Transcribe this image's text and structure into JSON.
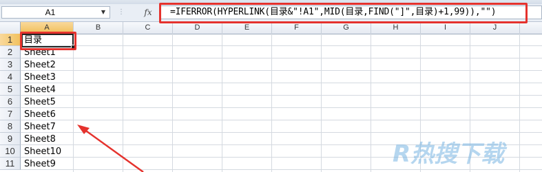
{
  "name_box": {
    "value": "A1"
  },
  "formula_bar": {
    "fx_label": "fx",
    "formula": "=IFERROR(HYPERLINK(目录&\"!A1\",MID(目录,FIND(\"]\",目录)+1,99)),\"\")"
  },
  "columns": [
    "A",
    "B",
    "C",
    "D",
    "E",
    "F",
    "G",
    "H",
    "I",
    "J"
  ],
  "rows": [
    "1",
    "2",
    "3",
    "4",
    "5",
    "6",
    "7",
    "8",
    "9",
    "10",
    "11"
  ],
  "column_a": [
    "目录",
    "Sheet1",
    "Sheet2",
    "Sheet3",
    "Sheet4",
    "Sheet5",
    "Sheet6",
    "Sheet7",
    "Sheet8",
    "Sheet10",
    "Sheet9"
  ],
  "selected_cell": "A1",
  "colors": {
    "highlight": "#e5322d",
    "selection": "#f1c15f"
  },
  "watermark": "R热搜下载"
}
